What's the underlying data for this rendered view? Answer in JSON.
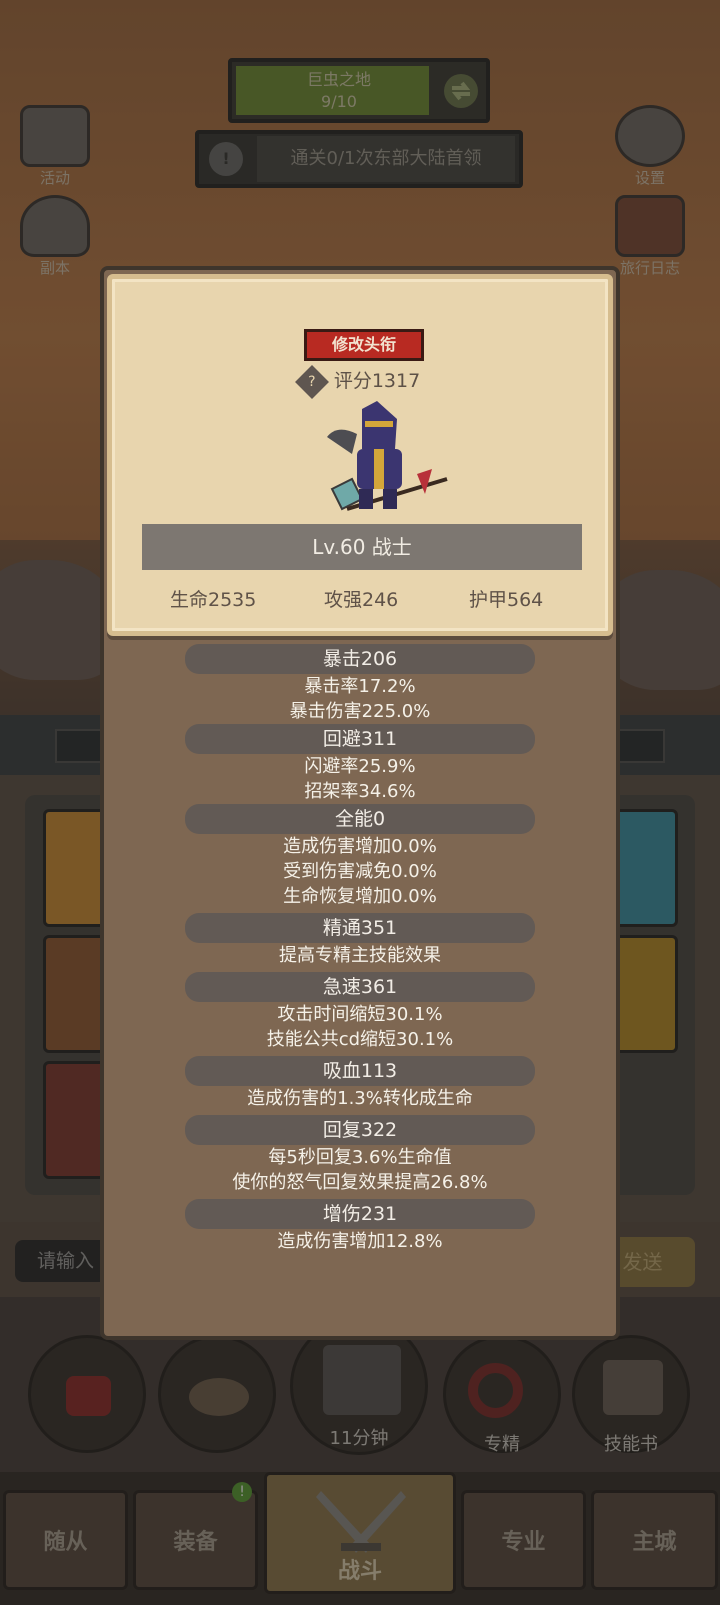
{
  "hud": {
    "zone_name": "巨虫之地",
    "zone_progress": "9/10",
    "zone_progress_fraction": 0.9,
    "quest_text": "通关0/1次东部大陆首领",
    "activity_label": "活动",
    "dungeon_label": "副本",
    "settings_label": "设置",
    "journal_label": "旅行日志"
  },
  "chat": {
    "input_placeholder": "请输入",
    "send_label": "发送"
  },
  "skills": {
    "chest_timer": "11分钟",
    "specialization_label": "专精",
    "skillbook_label": "技能书"
  },
  "tabs": {
    "followers": "随从",
    "equipment": "装备",
    "battle": "战斗",
    "profession": "专业",
    "main_city": "主城"
  },
  "character": {
    "title_button": "修改头衔",
    "score": "评分1317",
    "level_class": "Lv.60 战士",
    "hp": "生命2535",
    "attack": "攻强246",
    "armor": "护甲564"
  },
  "stats": {
    "crit": {
      "title": "暴击206",
      "lines": [
        "暴击率17.2%",
        "暴击伤害225.0%"
      ]
    },
    "dodge": {
      "title": "回避311",
      "lines": [
        "闪避率25.9%",
        "招架率34.6%"
      ]
    },
    "versatility": {
      "title": "全能0",
      "lines": [
        "造成伤害增加0.0%",
        "受到伤害减免0.0%",
        "生命恢复增加0.0%"
      ]
    },
    "mastery": {
      "title": "精通351",
      "lines": [
        "提高专精主技能效果"
      ]
    },
    "haste": {
      "title": "急速361",
      "lines": [
        "攻击时间缩短30.1%",
        "技能公共cd缩短30.1%"
      ]
    },
    "leech": {
      "title": "吸血113",
      "lines": [
        "造成伤害的1.3%转化成生命"
      ]
    },
    "regen": {
      "title": "回复322",
      "lines": [
        "每5秒回复3.6%生命值",
        "使你的怒气回复效果提高26.8%"
      ]
    },
    "damage": {
      "title": "增伤231",
      "lines": [
        "造成伤害增加12.8%"
      ]
    }
  },
  "colors": {
    "panel_bg": "#7e6752",
    "header_bg": "#e8d5ae",
    "title_button_bg": "#b82a22",
    "section_pill_bg": "#625a55"
  },
  "icons": {
    "activity": "castle-gate-icon",
    "dungeon": "portal-crystal-icon",
    "settings": "gear-icon",
    "journal": "journal-book-icon",
    "zone_swap": "swap-arrows-icon",
    "quest": "exclamation-icon",
    "score_help": "question-diamond-icon"
  }
}
